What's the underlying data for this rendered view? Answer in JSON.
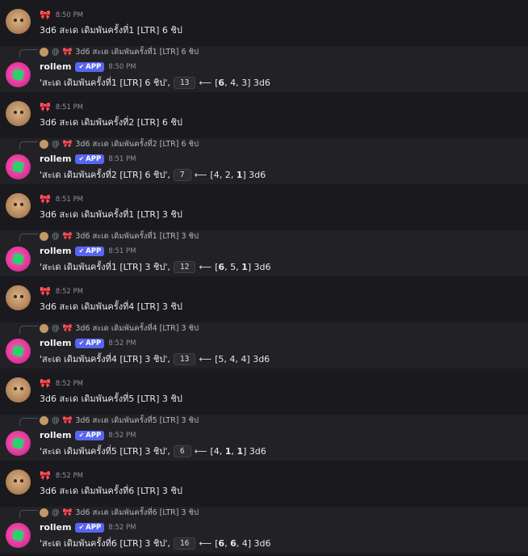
{
  "user": {
    "icon": "bow-icon",
    "icon_glyph": "🎀"
  },
  "bot": {
    "name": "rollem",
    "badge": "APP",
    "badge_icon": "check-icon"
  },
  "reply_prefix_at": "@",
  "arrow": "⟵",
  "messages": [
    {
      "time": "8:50 PM",
      "command": "3d6  สะเด เดิมพันครั้งที่1 [LTR] 6 ชิป",
      "bot_time": "8:50 PM",
      "label": "'สะเด เดิมพันครั้งที่1 [LTR] 6 ชิป',",
      "total": "13",
      "rolls": [
        {
          "v": "6",
          "max": true
        },
        {
          "v": "4",
          "max": false
        },
        {
          "v": "3",
          "max": false
        }
      ],
      "dice": "3d6"
    },
    {
      "time": "8:51 PM",
      "command": "3d6  สะเด เดิมพันครั้งที่2 [LTR] 6 ชิป",
      "bot_time": "8:51 PM",
      "label": "'สะเด เดิมพันครั้งที่2 [LTR] 6 ชิป',",
      "total": "7",
      "rolls": [
        {
          "v": "4",
          "max": false
        },
        {
          "v": "2",
          "max": false
        },
        {
          "v": "1",
          "max": true
        }
      ],
      "dice": "3d6"
    },
    {
      "time": "8:51 PM",
      "command": "3d6  สะเด เดิมพันครั้งที่1 [LTR] 3 ชิป",
      "bot_time": "8:51 PM",
      "label": "'สะเด เดิมพันครั้งที่1 [LTR] 3 ชิป',",
      "total": "12",
      "rolls": [
        {
          "v": "6",
          "max": true
        },
        {
          "v": "5",
          "max": false
        },
        {
          "v": "1",
          "max": true
        }
      ],
      "dice": "3d6"
    },
    {
      "time": "8:52 PM",
      "command": "3d6  สะเด เดิมพันครั้งที่4 [LTR] 3 ชิป",
      "bot_time": "8:52 PM",
      "label": "'สะเด เดิมพันครั้งที่4 [LTR] 3 ชิป',",
      "total": "13",
      "rolls": [
        {
          "v": "5",
          "max": false
        },
        {
          "v": "4",
          "max": false
        },
        {
          "v": "4",
          "max": false
        }
      ],
      "dice": "3d6"
    },
    {
      "time": "8:52 PM",
      "command": "3d6  สะเด เดิมพันครั้งที่5 [LTR] 3 ชิป",
      "bot_time": "8:52 PM",
      "label": "'สะเด เดิมพันครั้งที่5 [LTR] 3 ชิป',",
      "total": "6",
      "rolls": [
        {
          "v": "4",
          "max": false
        },
        {
          "v": "1",
          "max": true
        },
        {
          "v": "1",
          "max": true
        }
      ],
      "dice": "3d6"
    },
    {
      "time": "8:52 PM",
      "command": "3d6  สะเด เดิมพันครั้งที่6 [LTR] 3 ชิป",
      "bot_time": "8:52 PM",
      "label": "'สะเด เดิมพันครั้งที่6 [LTR] 3 ชิป',",
      "total": "16",
      "rolls": [
        {
          "v": "6",
          "max": true
        },
        {
          "v": "6",
          "max": true
        },
        {
          "v": "4",
          "max": false
        }
      ],
      "dice": "3d6"
    }
  ]
}
